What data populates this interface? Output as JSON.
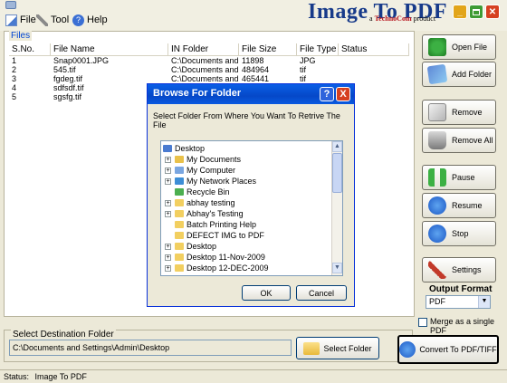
{
  "menu": {
    "file": "File",
    "tool": "Tool",
    "help": "Help"
  },
  "app": {
    "title": "Image To PDF",
    "subtitle_prefix": "a ",
    "subtitle_brand": "TechnoCom",
    "subtitle_suffix": " product"
  },
  "files": {
    "legend": "Files",
    "columns": [
      "S.No.",
      "File Name",
      "IN Folder",
      "File Size",
      "File Type",
      "Status"
    ],
    "rows": [
      [
        "1",
        "Snap0001.JPG",
        "C:\\Documents and...",
        "11898",
        "JPG",
        ""
      ],
      [
        "2",
        "545.tif",
        "C:\\Documents and...",
        "484964",
        "tif",
        ""
      ],
      [
        "3",
        "fgdeg.tif",
        "C:\\Documents and...",
        "465441",
        "tif",
        ""
      ],
      [
        "4",
        "sdfsdf.tif",
        "",
        "",
        "",
        ""
      ],
      [
        "5",
        "sgsfg.tif",
        "",
        "",
        "",
        ""
      ]
    ]
  },
  "dialog": {
    "title": "Browse For Folder",
    "help_glyph": "?",
    "close_glyph": "X",
    "prompt": "Select Folder From Where You Want To Retrive The File",
    "tree": [
      {
        "label": "Desktop",
        "expander": "",
        "icon": "desktop-icon",
        "indent": 0
      },
      {
        "label": "My Documents",
        "expander": "+",
        "icon": "my-documents-icon",
        "indent": 1
      },
      {
        "label": "My Computer",
        "expander": "+",
        "icon": "my-computer-icon",
        "indent": 1
      },
      {
        "label": "My Network Places",
        "expander": "+",
        "icon": "network-places-icon",
        "indent": 1
      },
      {
        "label": "Recycle Bin",
        "expander": "",
        "icon": "recycle-bin-icon",
        "indent": 1
      },
      {
        "label": "abhay testing",
        "expander": "+",
        "icon": "folder-icon",
        "indent": 1
      },
      {
        "label": "Abhay's Testing",
        "expander": "+",
        "icon": "folder-icon",
        "indent": 1
      },
      {
        "label": "Batch Printing Help",
        "expander": "",
        "icon": "folder-icon",
        "indent": 1
      },
      {
        "label": "DEFECT IMG to PDF",
        "expander": "",
        "icon": "folder-icon",
        "indent": 1
      },
      {
        "label": "Desktop",
        "expander": "+",
        "icon": "folder-icon",
        "indent": 1
      },
      {
        "label": "Desktop 11-Nov-2009",
        "expander": "+",
        "icon": "folder-icon",
        "indent": 1
      },
      {
        "label": "Desktop 12-DEC-2009",
        "expander": "+",
        "icon": "folder-icon",
        "indent": 1
      }
    ],
    "ok": "OK",
    "cancel": "Cancel"
  },
  "buttons": {
    "open_file": "Open File",
    "add_folder": "Add Folder",
    "remove": "Remove",
    "remove_all": "Remove All",
    "pause": "Pause",
    "resume": "Resume",
    "stop": "Stop",
    "settings": "Settings"
  },
  "output": {
    "label": "Output Format",
    "selected": "PDF"
  },
  "merge": {
    "label": "Merge as a single PDF",
    "checked": false
  },
  "destination": {
    "legend": "Select Destination  Folder",
    "value": "C:\\Documents and Settings\\Admin\\Desktop",
    "select_button": "Select Folder"
  },
  "convert": {
    "label": "Convert To PDF/TIFF"
  },
  "status": {
    "label": "Status:",
    "value": "Image To PDF"
  },
  "colors": {
    "accent": "#0a5fe6",
    "title_blue": "#173a8a",
    "brand_red": "#b8141c",
    "window_bg": "#ece9d8"
  }
}
